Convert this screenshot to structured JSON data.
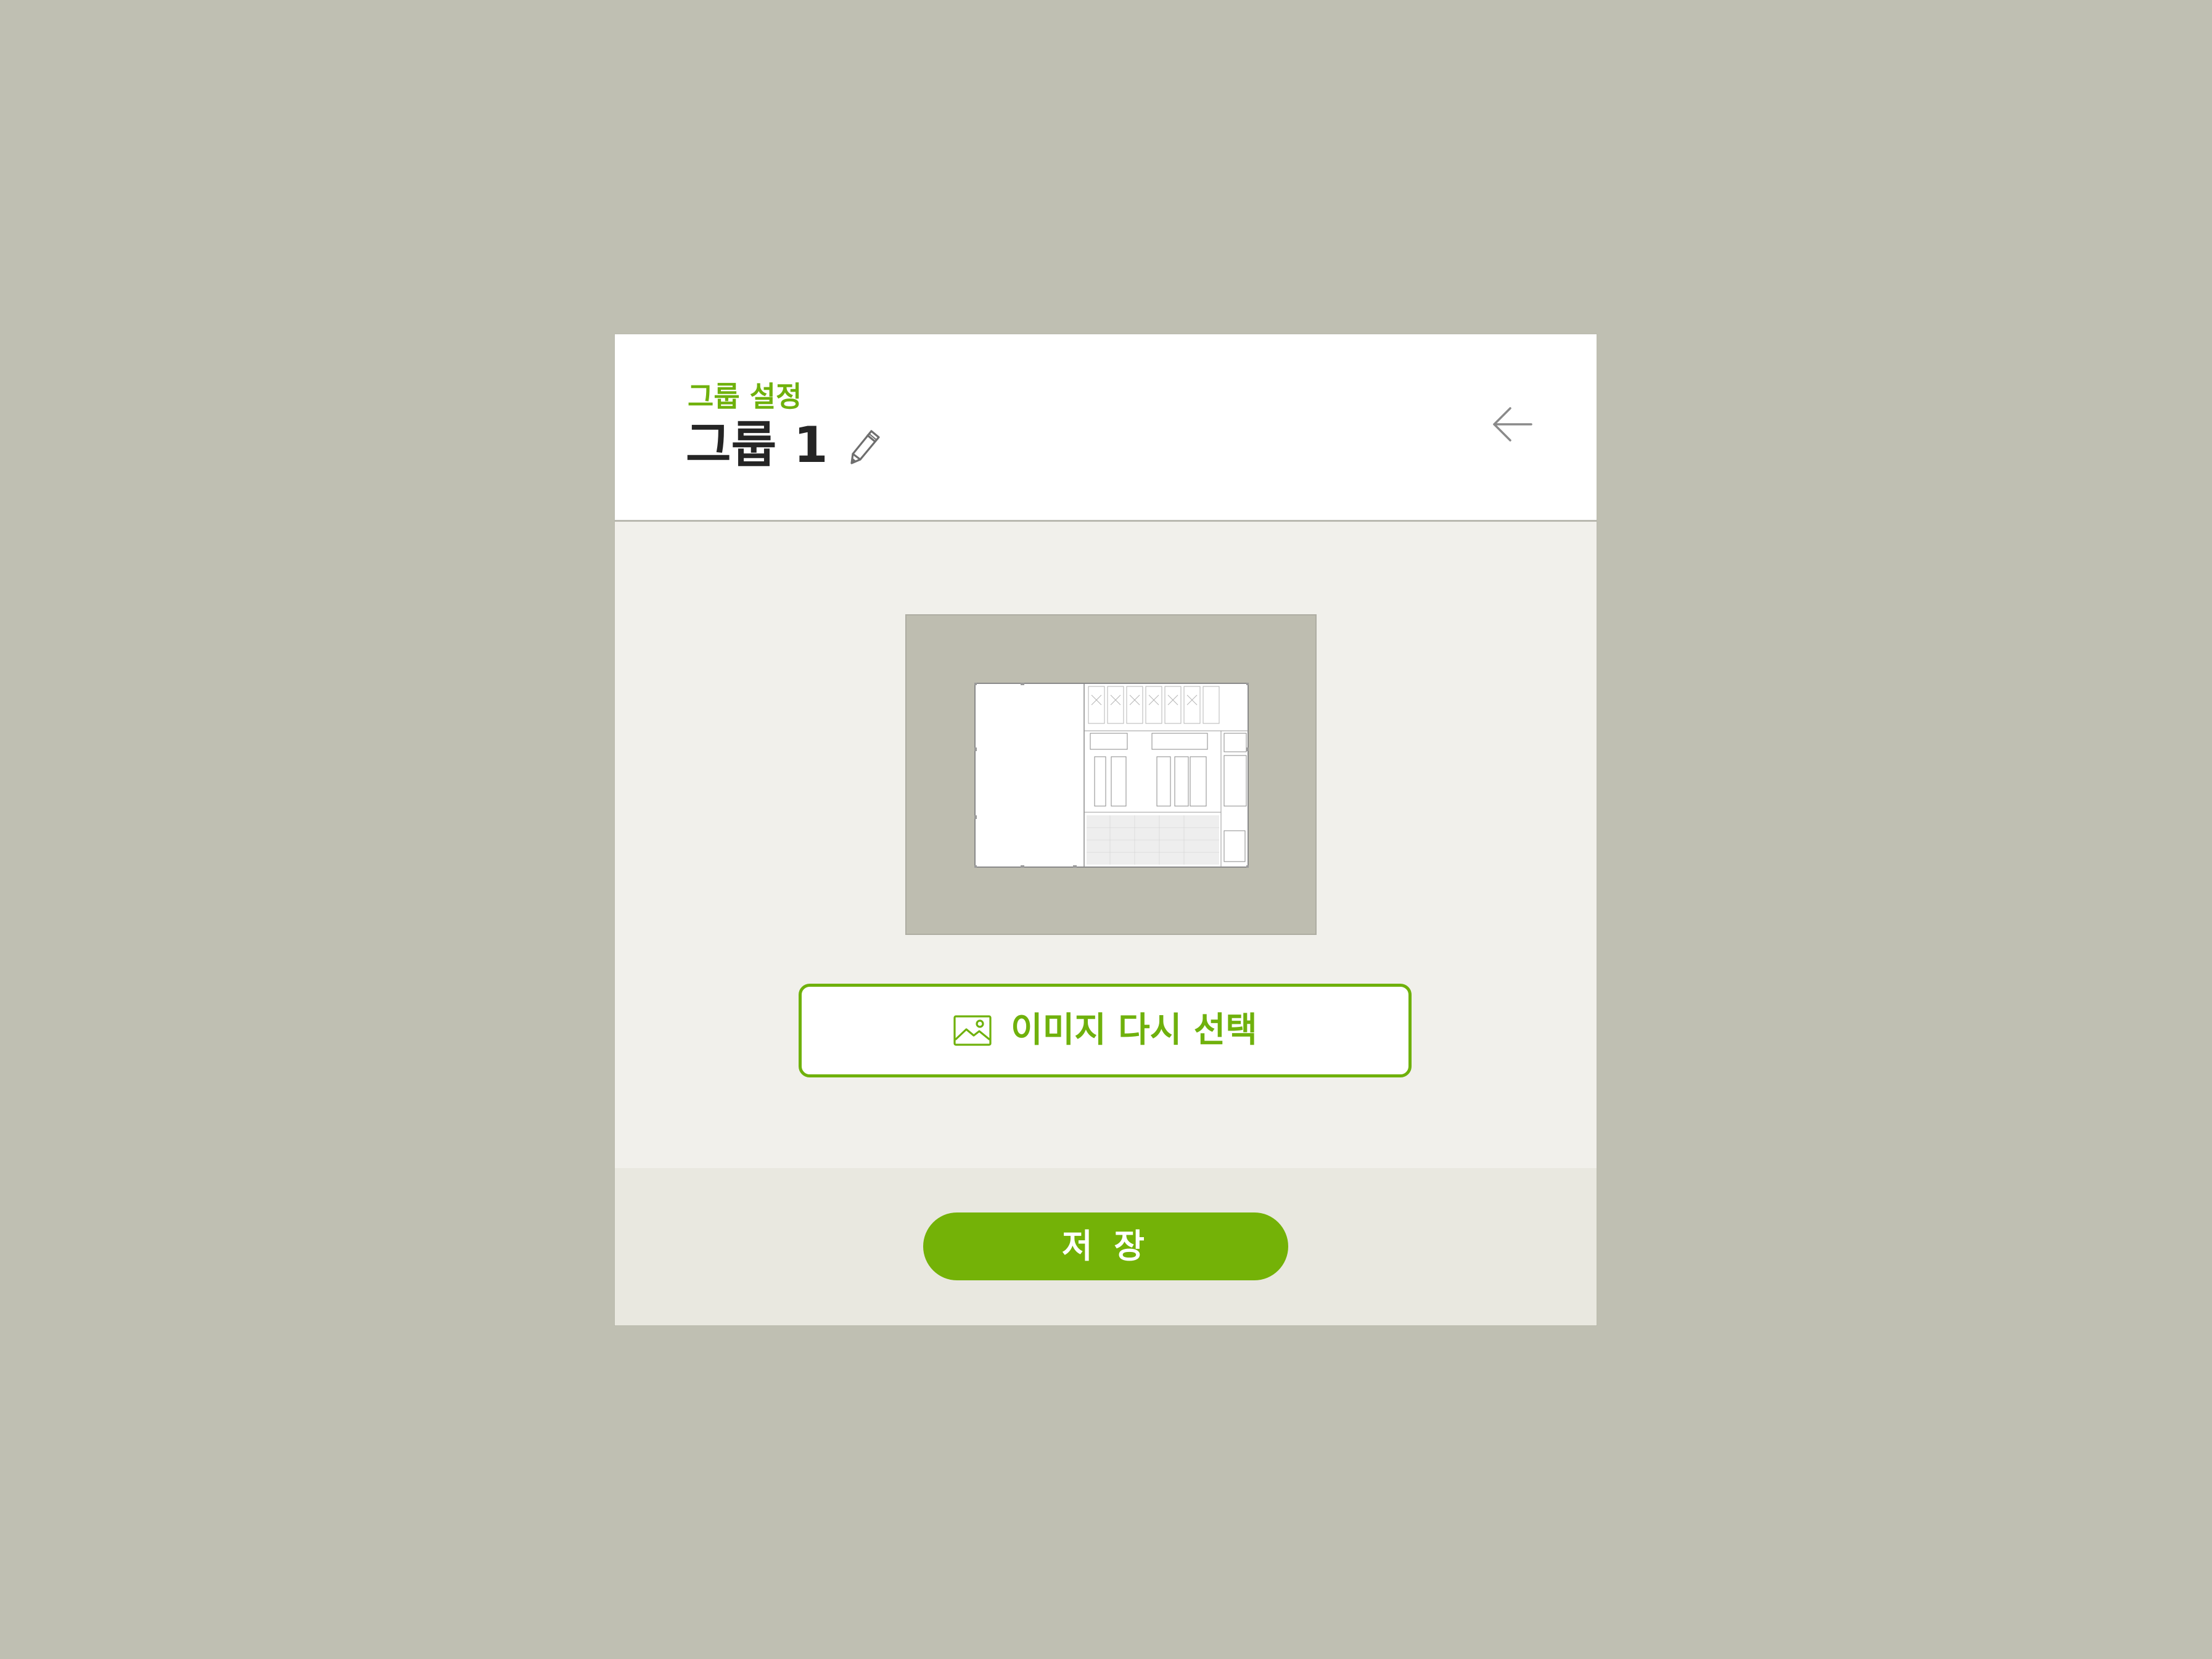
{
  "dialog": {
    "subtitle": "그룹 설정",
    "title": "그룹 1",
    "edit_icon": "pencil-icon",
    "back_icon": "arrow-left-icon"
  },
  "preview": {
    "image": "floor-plan-image"
  },
  "reselect_button": {
    "icon": "image-icon",
    "label": "이미지 다시 선택"
  },
  "save_button": {
    "label": "저 장"
  },
  "colors": {
    "accent": "#6fb10c",
    "save_button": "#74b207",
    "page_background": "#bfbfb2",
    "panel_background": "#f1f0eb",
    "footer_background": "#e9e8e0",
    "title_text": "#252525"
  }
}
